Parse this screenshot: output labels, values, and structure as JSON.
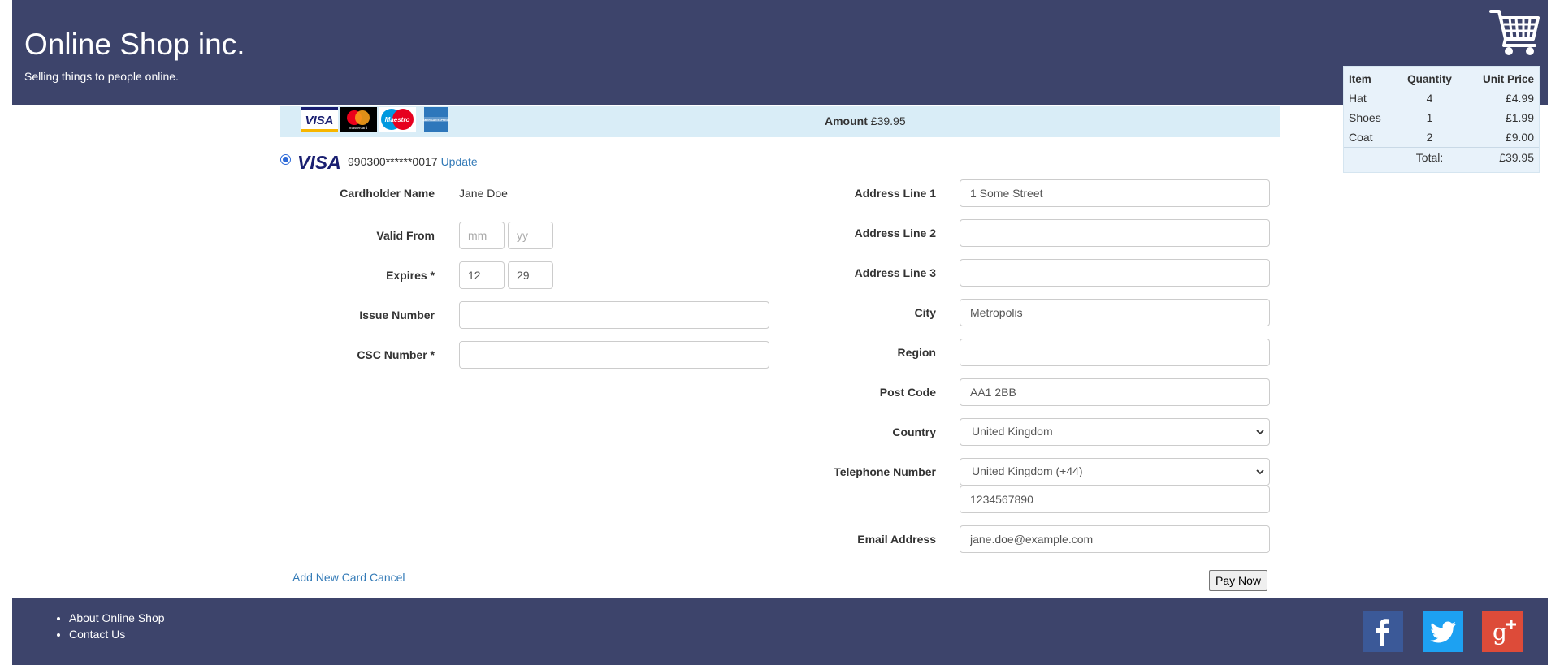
{
  "header": {
    "title": "Online Shop inc.",
    "tagline": "Selling things to people online."
  },
  "cart": {
    "icon": "shopping-cart-icon",
    "headers": {
      "item": "Item",
      "quantity": "Quantity",
      "unit_price": "Unit Price"
    },
    "rows": [
      {
        "item": "Hat",
        "quantity": "4",
        "unit_price": "£4.99"
      },
      {
        "item": "Shoes",
        "quantity": "1",
        "unit_price": "£1.99"
      },
      {
        "item": "Coat",
        "quantity": "2",
        "unit_price": "£9.00"
      }
    ],
    "total_label": "Total:",
    "total_value": "£39.95"
  },
  "payment_bar": {
    "card_logos": [
      "VISA",
      "mastercard",
      "Maestro",
      "AMERICAN EXPRESS"
    ],
    "amount_label": "Amount",
    "amount_value": "£39.95"
  },
  "saved_card": {
    "brand": "VISA",
    "masked_number": "990300******0017",
    "update_label": "Update"
  },
  "card_form": {
    "cardholder_label": "Cardholder Name",
    "cardholder_value": "Jane Doe",
    "valid_from_label": "Valid From",
    "valid_from_month_placeholder": "mm",
    "valid_from_year_placeholder": "yy",
    "expires_label": "Expires *",
    "expires_month": "12",
    "expires_year": "29",
    "issue_number_label": "Issue Number",
    "issue_number_value": "",
    "csc_label": "CSC Number *",
    "csc_value": ""
  },
  "address_form": {
    "line1_label": "Address Line 1",
    "line1_value": "1 Some Street",
    "line2_label": "Address Line 2",
    "line2_value": "",
    "line3_label": "Address Line 3",
    "line3_value": "",
    "city_label": "City",
    "city_value": "Metropolis",
    "region_label": "Region",
    "region_value": "",
    "postcode_label": "Post Code",
    "postcode_value": "AA1 2BB",
    "country_label": "Country",
    "country_value": "United Kingdom",
    "telephone_label": "Telephone Number",
    "telephone_country_value": "United Kingdom (+44)",
    "telephone_value": "1234567890",
    "email_label": "Email Address",
    "email_value": "jane.doe@example.com"
  },
  "actions": {
    "add_new_card": "Add New Card",
    "cancel": "Cancel",
    "pay_now": "Pay Now"
  },
  "footer": {
    "links": [
      "About Online Shop",
      "Contact Us"
    ],
    "social_icons": [
      "facebook-icon",
      "twitter-icon",
      "google-plus-icon"
    ]
  },
  "colors": {
    "header_bg": "#3d446b",
    "pay_bar_bg": "#d9edf7",
    "cart_bg": "#e8f2fa",
    "link": "#337ab7",
    "facebook": "#3b5998",
    "twitter": "#1da1f2",
    "google_plus": "#dd4b39"
  }
}
